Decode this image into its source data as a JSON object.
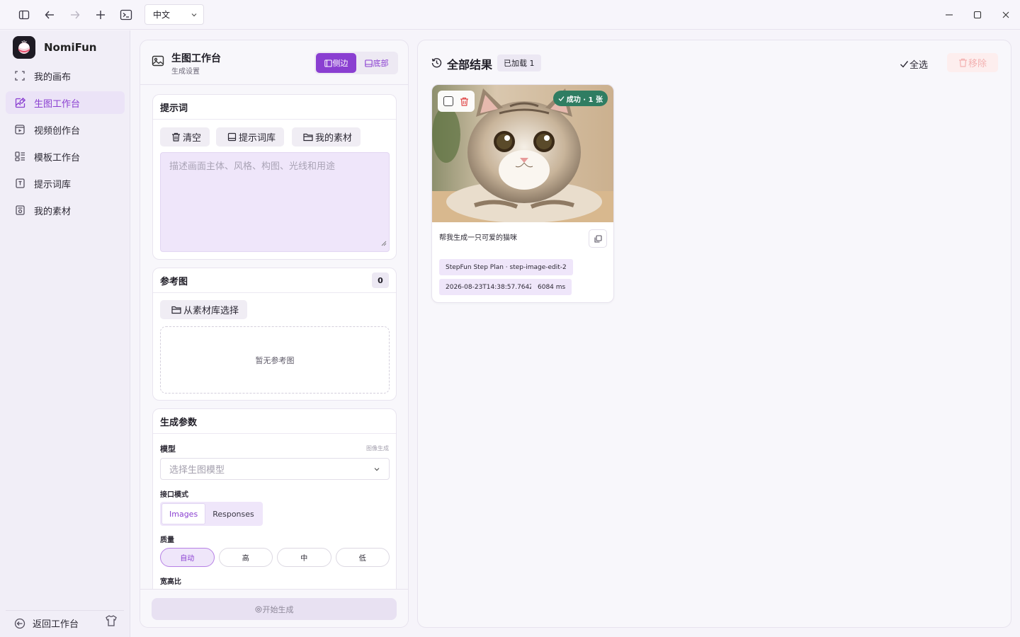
{
  "titlebar": {
    "language": "中文"
  },
  "sidebar": {
    "brand": "NomiFun",
    "items": [
      {
        "label": "我的画布",
        "icon": "canvas-frame-icon"
      },
      {
        "label": "生图工作台",
        "icon": "image-edit-icon",
        "active": true
      },
      {
        "label": "视频创作台",
        "icon": "video-icon"
      },
      {
        "label": "模板工作台",
        "icon": "template-icon"
      },
      {
        "label": "提示词库",
        "icon": "prompt-book-icon"
      },
      {
        "label": "我的素材",
        "icon": "materials-icon"
      }
    ],
    "back_label": "返回工作台"
  },
  "panel": {
    "title": "生图工作台",
    "subtitle": "生成设置",
    "layout_side": "侧边",
    "layout_bottom": "底部",
    "prompt": {
      "heading": "提示词",
      "clear": "清空",
      "library": "提示词库",
      "materials": "我的素材",
      "placeholder": "描述画面主体、风格、构图、光线和用途"
    },
    "reference": {
      "heading": "参考图",
      "count": "0",
      "choose": "从素材库选择",
      "empty": "暂无参考图"
    },
    "params": {
      "heading": "生成参数",
      "model_label": "模型",
      "model_hint": "图像生成",
      "model_placeholder": "选择生图模型",
      "api_label": "接口模式",
      "api_options": [
        "Images",
        "Responses"
      ],
      "quality_label": "质量",
      "quality_options": [
        "自动",
        "高",
        "中",
        "低"
      ],
      "ratio_label": "宽高比"
    },
    "generate": "开始生成"
  },
  "results": {
    "title": "全部结果",
    "loaded": "已加载 1",
    "select_all": "全选",
    "remove": "移除",
    "card": {
      "status": "成功 · 1 张",
      "prompt": "帮我生成一只可爱的猫咪",
      "model": "StepFun Step Plan · step-image-edit-2",
      "timestamp": "2026-08-23T14:38:57.764Z",
      "duration": "6084 ms"
    }
  },
  "colors": {
    "accent": "#8a3fd1",
    "success": "#2f7d62",
    "danger": "#e04848"
  }
}
